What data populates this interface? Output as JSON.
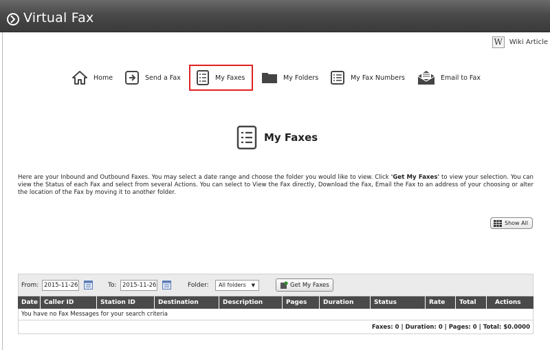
{
  "header": {
    "title": "Virtual Fax"
  },
  "wiki": {
    "icon_letter": "W",
    "label": "Wiki Article"
  },
  "nav": [
    {
      "label": "Home",
      "icon": "home-icon"
    },
    {
      "label": "Send a Fax",
      "icon": "send-icon"
    },
    {
      "label": "My Faxes",
      "icon": "list-icon",
      "active": true
    },
    {
      "label": "My Folders",
      "icon": "folder-icon"
    },
    {
      "label": "My Fax Numbers",
      "icon": "list-icon"
    },
    {
      "label": "Email to Fax",
      "icon": "envelope-icon"
    }
  ],
  "page": {
    "title": "My Faxes",
    "desc_part1": "Here are your Inbound and Outbound Faxes. You may select a date range and choose the folder you would like to view. Click ",
    "desc_bold": "'Get My Faxes'",
    "desc_part2": " to view your selection. You can view the Status of each Fax and select from several Actions. You can select to View the Fax directly, Download the Fax, Email the Fax to an address of your choosing or alter the location of the Fax by moving it to another folder.",
    "show_all": "Show All"
  },
  "filter": {
    "from_label": "From:",
    "from_value": "2015-11-26",
    "to_label": "To:",
    "to_value": "2015-11-26",
    "folder_label": "Folder:",
    "folder_value": "All folders",
    "get_button": "Get My Faxes"
  },
  "table": {
    "columns": [
      "Date",
      "Caller ID",
      "Station ID",
      "Destination",
      "Description",
      "Pages",
      "Duration",
      "Status",
      "Rate",
      "Total",
      "Actions"
    ],
    "empty_message": "You have no Fax Messages for your search criteria",
    "totals": "Faxes: 0 | Duration: 0 | Pages: 0 | Total: $0.0000"
  },
  "colors": {
    "header_bg": "#4a4a4a",
    "active_outline": "#e02020",
    "table_header": "#4a4a4a"
  }
}
